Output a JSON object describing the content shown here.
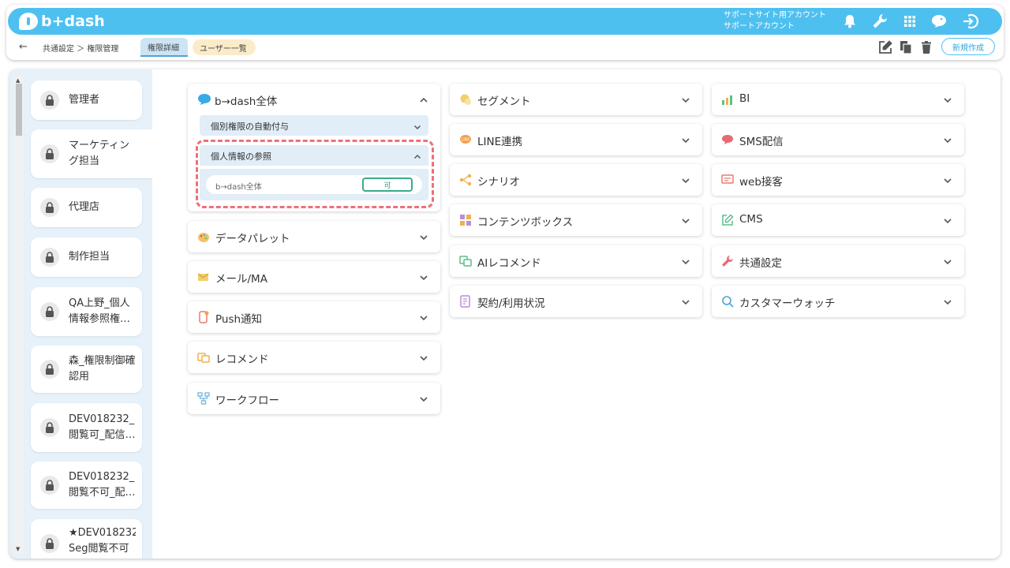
{
  "header": {
    "logo_text": "b+dash",
    "account_line1": "サポートサイト用アカウント",
    "account_line2": "サポートアカウント",
    "breadcrumb": "共通設定 ＞ 権限管理",
    "tabs": [
      {
        "label": "権限詳細",
        "active": true
      },
      {
        "label": "ユーザー一覧",
        "active": false
      }
    ],
    "new_button": "新規作成"
  },
  "roles": [
    {
      "label": "管理者"
    },
    {
      "label": "マーケティング担当",
      "active": true
    },
    {
      "label": "代理店"
    },
    {
      "label": "制作担当"
    },
    {
      "label": "QA上野_個人情報参照権…"
    },
    {
      "label": "森_権限制御確認用"
    },
    {
      "label": "DEV018232_閲覧可_配信…"
    },
    {
      "label": "DEV018232_閲覧不可_配…"
    },
    {
      "label": "★DEV018232 Seg閲覧不可"
    }
  ],
  "expanded_category": {
    "label": "b→dash全体",
    "subs": [
      {
        "label": "個別権限の自動付与",
        "expanded": false
      },
      {
        "label": "個人情報の参照",
        "expanded": true
      }
    ],
    "permission": {
      "label": "b→dash全体",
      "value": "可"
    }
  },
  "col1": [
    {
      "label": "データパレット",
      "icon": "palette-icon"
    },
    {
      "label": "メール/MA",
      "icon": "mail-icon"
    },
    {
      "label": "Push通知",
      "icon": "push-icon"
    },
    {
      "label": "レコメンド",
      "icon": "recommend-icon"
    },
    {
      "label": "ワークフロー",
      "icon": "workflow-icon"
    }
  ],
  "col2": [
    {
      "label": "セグメント",
      "icon": "segment-icon"
    },
    {
      "label": "LINE連携",
      "icon": "line-icon"
    },
    {
      "label": "シナリオ",
      "icon": "scenario-icon"
    },
    {
      "label": "コンテンツボックス",
      "icon": "contents-box-icon"
    },
    {
      "label": "AIレコメンド",
      "icon": "ai-recommend-icon"
    },
    {
      "label": "契約/利用状況",
      "icon": "contract-icon"
    }
  ],
  "col3": [
    {
      "label": "BI",
      "icon": "bi-icon"
    },
    {
      "label": "SMS配信",
      "icon": "sms-icon"
    },
    {
      "label": "web接客",
      "icon": "web-service-icon"
    },
    {
      "label": "CMS",
      "icon": "cms-icon"
    },
    {
      "label": "共通設定",
      "icon": "common-settings-icon"
    },
    {
      "label": "カスタマーウォッチ",
      "icon": "customer-watch-icon"
    }
  ],
  "colors": {
    "brand": "#4ec0f0",
    "highlight": "#ee7078",
    "badge": "#3aaa8a"
  }
}
